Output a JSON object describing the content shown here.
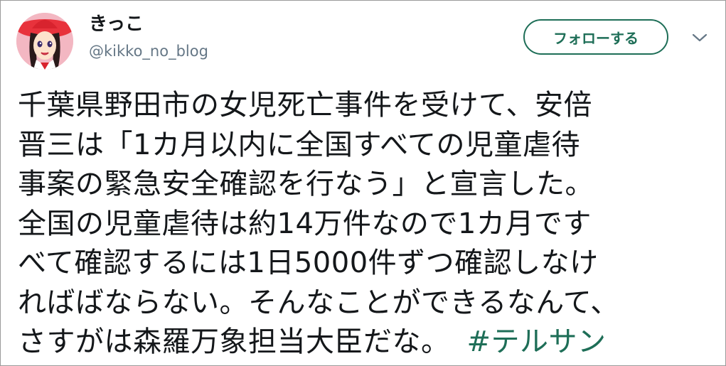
{
  "user": {
    "display_name": "きっこ",
    "handle": "@kikko_no_blog",
    "avatar_icon": "avatar-illustration-icon"
  },
  "header": {
    "follow_label": "フォローする",
    "more_icon": "chevron-down-icon"
  },
  "tweet": {
    "lines": [
      "千葉県野田市の女児死亡事件を受けて、安倍",
      "晋三は「1カ月以内に全国すべての児童虐待",
      "事案の緊急安全確認を行なう」と宣言した。",
      "全国の児童虐待は約14万件なので1カ月です",
      "べて確認するには1日5000件ずつ確認しなけ",
      "ればばならない。そんなことができるなんて、",
      "さすがは森羅万象担当大臣だな。"
    ],
    "hashtag": "#テルサン"
  },
  "colors": {
    "accent": "#1e6e57",
    "text": "#14171a",
    "secondary": "#657786"
  }
}
